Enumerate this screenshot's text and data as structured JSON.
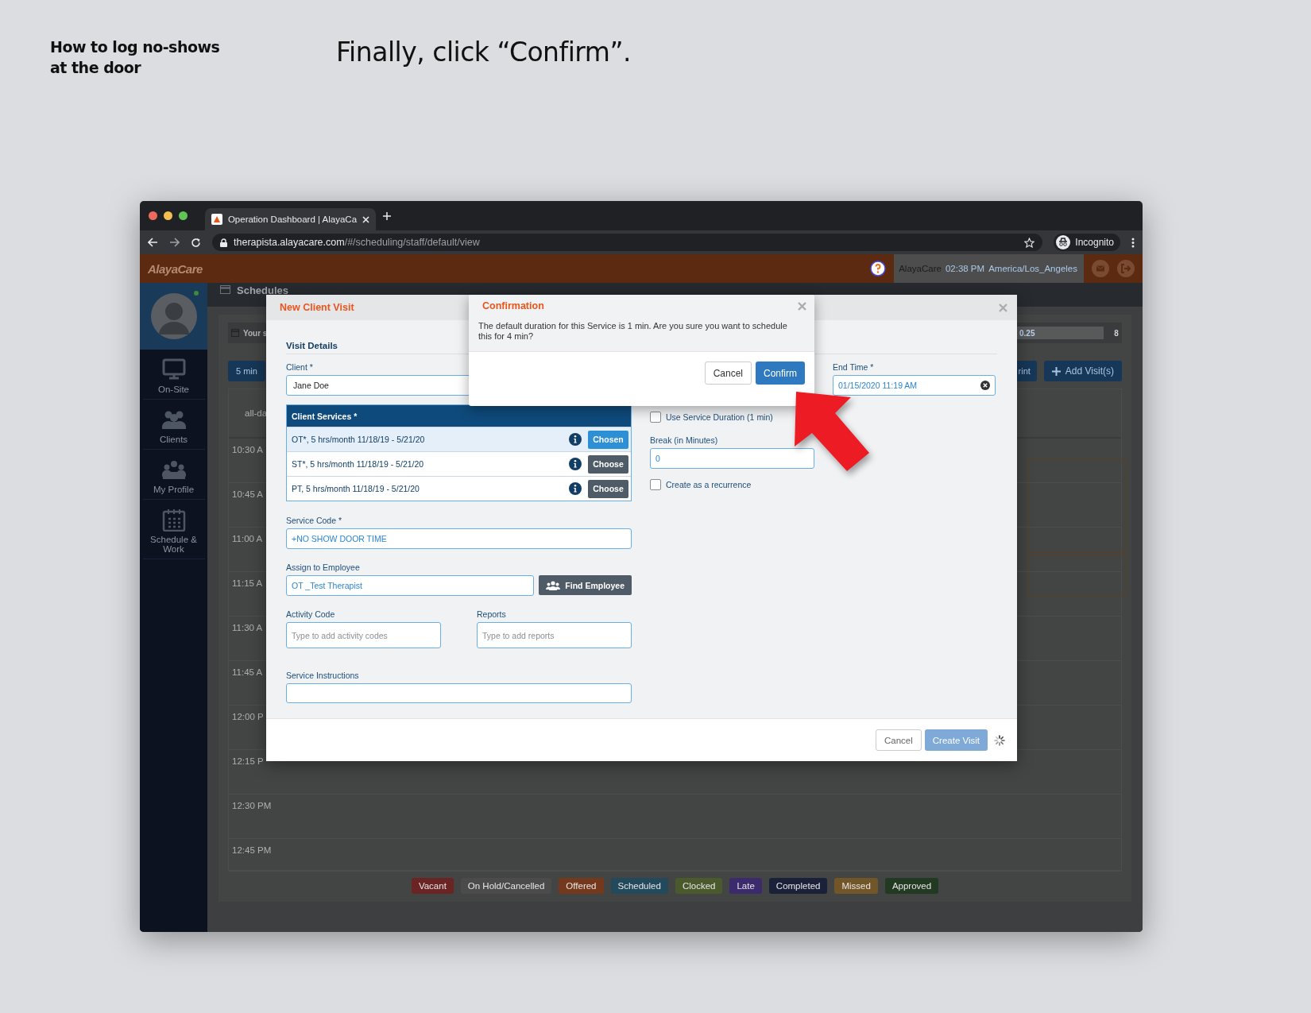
{
  "slide": {
    "title": "How to log no-shows at the door",
    "instruction": "Finally, click “Confirm”."
  },
  "browser": {
    "tab_title": "Operation Dashboard | AlayaCa",
    "url_host": "therapista.alayacare.com",
    "url_path": "/#/scheduling/staff/default/view",
    "profile": "Incognito"
  },
  "app_header": {
    "logo": "AlayaCare",
    "company": "AlayaCare",
    "time": "02:38 PM",
    "timezone": "America/Los_Angeles"
  },
  "sidebar": {
    "items": [
      {
        "label": "On-Site",
        "kind": "monitor"
      },
      {
        "label": "Clients",
        "kind": "people"
      },
      {
        "label": "My Profile",
        "kind": "group"
      },
      {
        "label": "Schedule & Work",
        "kind": "calendar"
      }
    ]
  },
  "schedule": {
    "title": "Schedules",
    "summary": "Your s",
    "progress_label": "0.25",
    "count": "8",
    "duration_button": "5 min",
    "print_button": "rint",
    "add_button": "Add Visit(s)",
    "all_day": "all-da",
    "times": [
      "10:30 A",
      "10:45 A",
      "11:00 A",
      "11:15 A",
      "11:30 A",
      "11:45 A",
      "12:00 P",
      "12:15 P",
      "12:30 PM",
      "12:45 PM"
    ]
  },
  "legend": [
    {
      "label": "Vacant",
      "color": "#6b2424"
    },
    {
      "label": "On Hold/Cancelled",
      "color": "#4b4b4b"
    },
    {
      "label": "Offered",
      "color": "#74391c"
    },
    {
      "label": "Scheduled",
      "color": "#22495c"
    },
    {
      "label": "Clocked",
      "color": "#4a5a2c"
    },
    {
      "label": "Late",
      "color": "#3b2a6c"
    },
    {
      "label": "Completed",
      "color": "#1c213a"
    },
    {
      "label": "Missed",
      "color": "#735628"
    },
    {
      "label": "Approved",
      "color": "#223a22"
    }
  ],
  "visit_modal": {
    "title": "New Client Visit",
    "section": "Visit Details",
    "client_label": "Client *",
    "client_value": "Jane Doe",
    "services_title": "Client Services *",
    "services": [
      {
        "label": "OT*, 5 hrs/month 11/18/19 - 5/21/20",
        "button": "Chosen",
        "selected": true
      },
      {
        "label": "ST*, 5 hrs/month 11/18/19 - 5/21/20",
        "button": "Choose",
        "selected": false
      },
      {
        "label": "PT, 5 hrs/month 11/18/19 - 5/21/20",
        "button": "Choose",
        "selected": false
      }
    ],
    "service_code_label": "Service Code *",
    "service_code": "+NO SHOW DOOR TIME",
    "assign_label": "Assign to Employee",
    "employee": "OT _Test Therapist",
    "find_button": "Find Employee",
    "activity_label": "Activity Code",
    "activity_placeholder": "Type to add activity codes",
    "reports_label": "Reports",
    "reports_placeholder": "Type to add reports",
    "instructions_label": "Service Instructions",
    "use_duration": {
      "label": "Use Service Duration (1 min)",
      "checked": false
    },
    "break_label": "Break (in Minutes)",
    "break_value": "0",
    "recurrence": {
      "label": "Create as a recurrence",
      "checked": false
    },
    "end_time_label": "End Time *",
    "end_time": "01/15/2020 11:19 AM",
    "cancel_button": "Cancel",
    "create_button": "Create Visit"
  },
  "confirmation": {
    "title": "Confirmation",
    "message": "The default duration for this Service is 1 min. Are you sure you want to schedule this for 4 min?",
    "cancel_button": "Cancel",
    "confirm_button": "Confirm"
  }
}
